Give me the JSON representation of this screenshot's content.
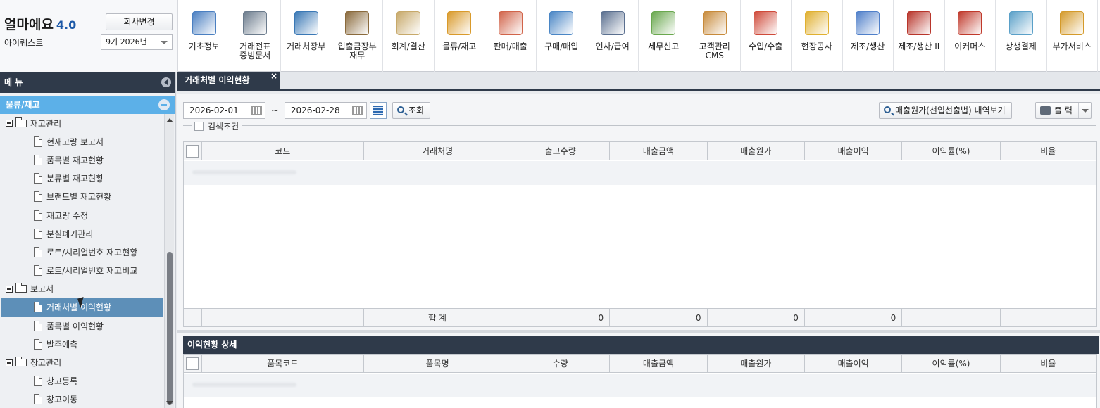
{
  "app": {
    "logo_text": "얼마에요",
    "version": "4.0",
    "company": "아이퀘스트",
    "change_company_label": "회사변경",
    "period": "9기 2026년"
  },
  "toolbar": [
    {
      "label": "기초정보",
      "icon": "basic-info-icon",
      "color": "#4a7fc1"
    },
    {
      "label": "거래전표\n증빙문서",
      "icon": "voucher-icon",
      "color": "#6b7b8c"
    },
    {
      "label": "거래처장부",
      "icon": "ledger-icon",
      "color": "#3a78b5"
    },
    {
      "label": "입출금장부\n재무",
      "icon": "money-bag-icon",
      "color": "#8a6a3c"
    },
    {
      "label": "회계/결산",
      "icon": "clipboard-icon",
      "color": "#c7a96a"
    },
    {
      "label": "물류/재고",
      "icon": "logistics-icon",
      "color": "#d99a2b"
    },
    {
      "label": "판매/매출",
      "icon": "sales-icon",
      "color": "#d1644a"
    },
    {
      "label": "구매/매입",
      "icon": "purchase-icon",
      "color": "#4a86c5"
    },
    {
      "label": "인사/급여",
      "icon": "hr-icon",
      "color": "#5a6f8f"
    },
    {
      "label": "세무신고",
      "icon": "tax-icon",
      "color": "#6aa84f"
    },
    {
      "label": "고객관리\nCMS",
      "icon": "customer-icon",
      "color": "#c78a3a"
    },
    {
      "label": "수입/수출",
      "icon": "ship-icon",
      "color": "#cf4a3a"
    },
    {
      "label": "현장공사",
      "icon": "construction-icon",
      "color": "#e0b030"
    },
    {
      "label": "제조/생산",
      "icon": "manufacturing-icon",
      "color": "#4f7fc9"
    },
    {
      "label": "제조/생산 II",
      "icon": "factory-icon",
      "color": "#b8352b"
    },
    {
      "label": "이커머스",
      "icon": "ecommerce-icon",
      "color": "#c0392b"
    },
    {
      "label": "상생결제",
      "icon": "payment-icon",
      "color": "#5aa0c8"
    },
    {
      "label": "부가서비스",
      "icon": "bank-icon",
      "color": "#d49a2a"
    }
  ],
  "sidebar": {
    "header": "메 뉴",
    "section": "물류/재고",
    "tree": [
      {
        "type": "folder",
        "label": "재고관리"
      },
      {
        "type": "item",
        "label": "현재고량 보고서"
      },
      {
        "type": "item",
        "label": "품목별 재고현황"
      },
      {
        "type": "item",
        "label": "분류별 재고현황"
      },
      {
        "type": "item",
        "label": "브랜드별 재고현황"
      },
      {
        "type": "item",
        "label": "재고량 수정"
      },
      {
        "type": "item",
        "label": "분실폐기관리"
      },
      {
        "type": "item",
        "label": "로트/시리얼번호 재고현황"
      },
      {
        "type": "item",
        "label": "로트/시리얼번호 재고비교"
      },
      {
        "type": "folder",
        "label": "보고서"
      },
      {
        "type": "item",
        "label": "거래처별 이익현황",
        "selected": true
      },
      {
        "type": "item",
        "label": "품목별 이익현황"
      },
      {
        "type": "item",
        "label": "발주예측"
      },
      {
        "type": "folder",
        "label": "창고관리"
      },
      {
        "type": "item",
        "label": "창고등록"
      },
      {
        "type": "item",
        "label": "창고이동"
      }
    ]
  },
  "tab": {
    "label": "거래처별 이익현황",
    "close": "×"
  },
  "search": {
    "date_from": "2026-02-01",
    "date_to": "2026-02-28",
    "tilde": "~",
    "search_label": "조회",
    "detail_label": "매출원가(선입선출법) 내역보기",
    "print_label": "출 력",
    "condition_label": "검색조건"
  },
  "grid1": {
    "columns": [
      "코드",
      "거래처명",
      "출고수량",
      "매출금액",
      "매출원가",
      "매출이익",
      "이익률(%)",
      "비율"
    ],
    "total_label": "합      계",
    "totals": [
      "0",
      "0",
      "0",
      "0"
    ]
  },
  "detail": {
    "title": "이익현황 상세",
    "columns": [
      "품목코드",
      "품목명",
      "수량",
      "매출금액",
      "매출원가",
      "매출이익",
      "이익률(%)",
      "비율"
    ]
  }
}
